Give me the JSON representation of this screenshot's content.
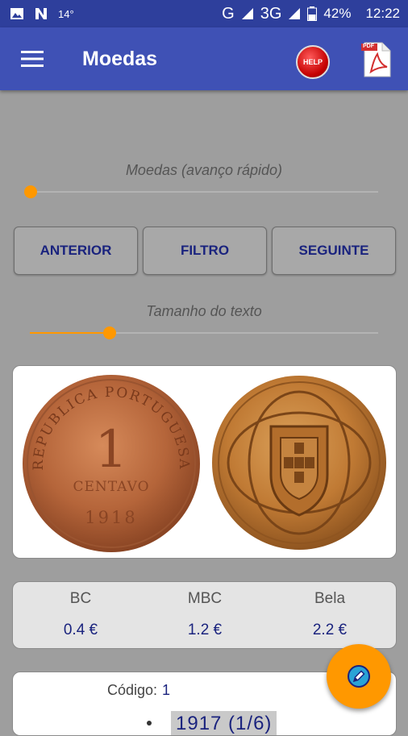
{
  "status_bar": {
    "temperature": "14°",
    "network": "G",
    "network2": "3G",
    "battery": "42%",
    "time": "12:22"
  },
  "app_bar": {
    "title": "Moedas",
    "help_label": "HELP",
    "pdf_label": "PDF"
  },
  "fast_slider": {
    "label": "Moedas (avanço rápido)",
    "value_fraction": 0.0
  },
  "buttons": {
    "previous": "ANTERIOR",
    "filter": "FILTRO",
    "next": "SEGUINTE"
  },
  "text_size_slider": {
    "label": "Tamanho do texto",
    "value_fraction": 0.23
  },
  "coin": {
    "obverse_text": "REPUBLICA PORTUGUESA",
    "value_digit": "1",
    "value_word": "CENTAVO",
    "year_stamp": "1918"
  },
  "prices": [
    {
      "grade": "BC",
      "value": "0.4 €"
    },
    {
      "grade": "MBC",
      "value": "1.2 €"
    },
    {
      "grade": "Bela",
      "value": "2.2 €"
    }
  ],
  "details": {
    "code_label": "Código:",
    "code_value": "1",
    "year_text": "1917 (1/6)"
  },
  "colors": {
    "primary": "#3f51b5",
    "accent": "#ff9800",
    "text_blue": "#1a237e"
  }
}
